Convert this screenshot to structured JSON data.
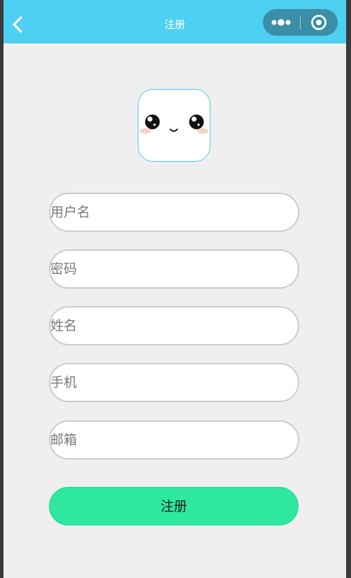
{
  "header": {
    "title": "注册"
  },
  "form": {
    "username_placeholder": "用户名",
    "password_placeholder": "密码",
    "name_placeholder": "姓名",
    "phone_placeholder": "手机",
    "email_placeholder": "邮箱",
    "submit_label": "注册"
  },
  "icons": {
    "back": "chevron-left-icon",
    "more": "more-dots-icon",
    "close": "target-circle-icon",
    "avatar": "kawaii-face-icon"
  },
  "colors": {
    "navbar": "#4dd0f2",
    "capsule": "#3a8ea5",
    "page_background": "#f0efef",
    "submit_button": "#2fe89f",
    "avatar_border": "#4dc8ee"
  }
}
